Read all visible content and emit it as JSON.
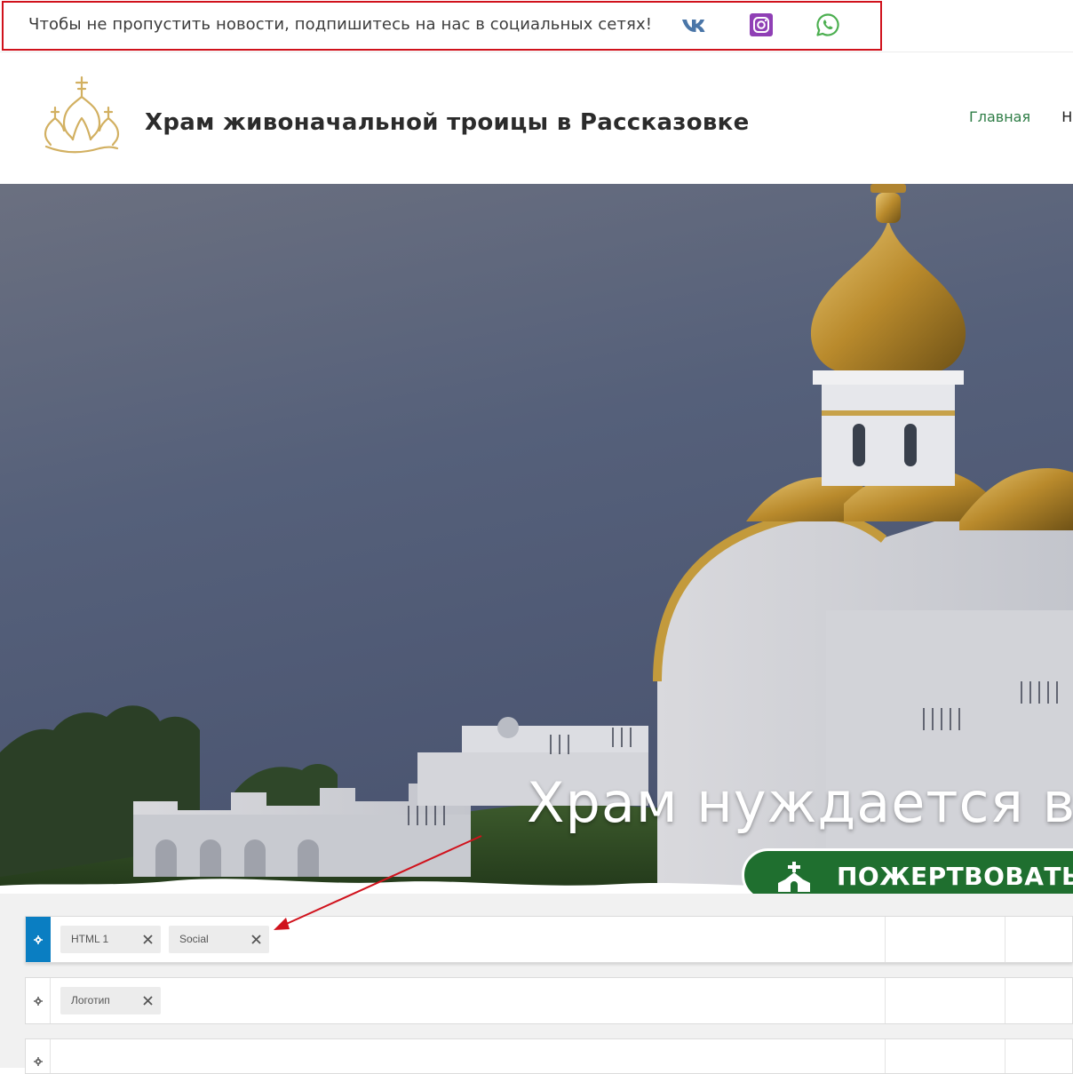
{
  "topbar": {
    "message": "Чтобы не пропустить новости, подпишитесь на нас в социальных сетях!",
    "social_icons": [
      "vk-icon",
      "instagram-icon",
      "whatsapp-icon"
    ],
    "highlight_color": "#d0121c"
  },
  "header": {
    "site_title": "Храм живоначальной троицы в Рассказовке",
    "nav": [
      {
        "label": "Главная",
        "active": true
      },
      {
        "label": "Но",
        "active": false
      }
    ],
    "accent_color": "#2e7d46"
  },
  "hero": {
    "heading": "Храм нуждается в",
    "donate_label": "ПОЖЕРТВОВАТЬ",
    "donate_icon": "church-icon",
    "button_color": "#1f6f2f"
  },
  "builder": {
    "rows": [
      {
        "chips": [
          "HTML 1",
          "Social"
        ],
        "selected": true
      },
      {
        "chips": [
          "Логотип"
        ],
        "selected": false
      },
      {
        "chips": [],
        "selected": false
      }
    ],
    "selected_color": "#0a7ec2"
  },
  "annotation": {
    "arrow_color": "#d0121c"
  }
}
